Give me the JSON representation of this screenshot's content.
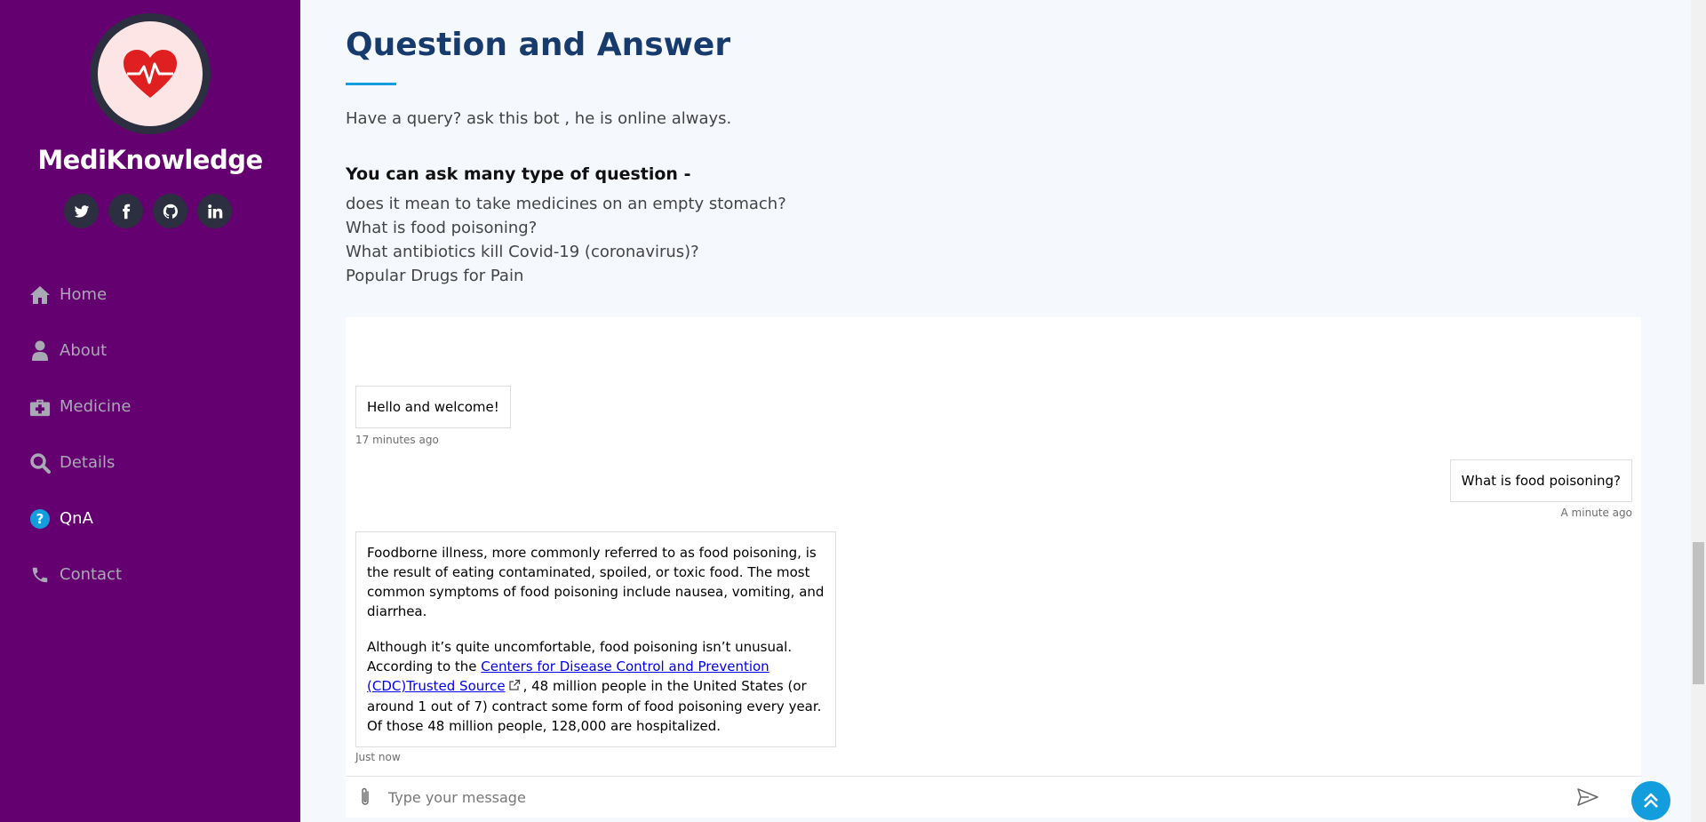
{
  "brand": "MediKnowledge",
  "social_icons": [
    "twitter-icon",
    "facebook-icon",
    "github-icon",
    "linkedin-icon"
  ],
  "nav": [
    {
      "label": "Home",
      "icon": "home-icon",
      "active": false
    },
    {
      "label": "About",
      "icon": "user-icon",
      "active": false
    },
    {
      "label": "Medicine",
      "icon": "medkit-icon",
      "active": false
    },
    {
      "label": "Details",
      "icon": "search-icon",
      "active": false
    },
    {
      "label": "QnA",
      "icon": "question-circle-icon",
      "active": true
    },
    {
      "label": "Contact",
      "icon": "phone-icon",
      "active": false
    }
  ],
  "section": {
    "title": "Question and Answer",
    "intro": "Have a query? ask this bot , he is online always.",
    "subhead": "You can ask many type of question -",
    "examples": [
      "does it mean to take medicines on an empty stomach?",
      "What is food poisoning?",
      "What antibiotics kill Covid-19 (coronavirus)?",
      "Popular Drugs for Pain"
    ]
  },
  "chat": {
    "messages": [
      {
        "from": "bot",
        "text": "Hello and welcome!",
        "time": "17 minutes ago"
      },
      {
        "from": "user",
        "text": "What is food poisoning?",
        "time": "A minute ago"
      },
      {
        "from": "bot",
        "para1": "Foodborne illness, more commonly referred to as food poisoning, is the result of eating contaminated, spoiled, or toxic food. The most common symptoms of food poisoning include nausea, vomiting, and diarrhea.",
        "para2_before": "Although it’s quite uncomfortable, food poisoning isn’t unusual. According to the ",
        "link_text": "Centers for Disease Control and Prevention (CDC)Trusted Source",
        "para2_after": ", 48 million people in the United States (or around 1 out of 7) contract some form of food poisoning every year. Of those 48 million people, 128,000 are hospitalized.",
        "time": "Just now"
      }
    ],
    "input_placeholder": "Type your message"
  },
  "colors": {
    "sidebar": "#650071",
    "accent": "#149ddd",
    "title": "#173b6c"
  }
}
